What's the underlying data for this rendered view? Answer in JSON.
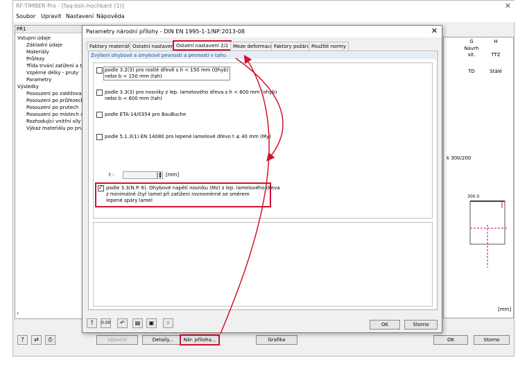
{
  "app": {
    "title": "RF-TIMBER Pro - [faq-bsh-hochkant (1)]",
    "close_glyph": "✕",
    "menu": [
      "Soubor",
      "Upravit",
      "Nastavení",
      "Nápověda"
    ],
    "tree_header": "PŘ1",
    "tree_items": [
      "Vstupní údaje",
      "Základní údaje",
      "Materiály",
      "Průřezy",
      "Třída trvání zatížení a třída",
      "Vzpěrné délky - pruty",
      "Parametry",
      "Výsledky",
      "Posouzení po zatěžovacích",
      "Posouzení po průřezech",
      "Posouzení po prutech",
      "Posouzení po místech x",
      "Rozhodující vnitřní síly po p",
      "Výkaz materiálu po prutech"
    ],
    "right_columns": {
      "g_head": "G",
      "h_head": "H",
      "g_sub1": "Návrh",
      "g_sub2": "sit.",
      "h_sub": "TTZ",
      "g_val": "TD",
      "h_val": "Stálé"
    },
    "section_label": "k 300/200",
    "dim_label": "300.0",
    "unit_label": "[mm]",
    "bottom_buttons": {
      "vypocet": "Výpočet",
      "detaily": "Detaily...",
      "nar_priloha": "Nár. příloha...",
      "grafika": "Grafika",
      "ok": "OK",
      "storno": "Storno"
    }
  },
  "dialog": {
    "title": "Parametry národní přílohy - DIN EN 1995-1-1/NP:2013-08",
    "close_glyph": "✕",
    "tabs": [
      "Faktory materiálu",
      "Ostatní nastavení",
      "Ostatní nastavení 2/2",
      "Meze deformace",
      "Faktory požáru",
      "Použité normy"
    ],
    "active_tab": "Ostatní nastavení 2/2",
    "group_header": "Zvýšení ohybové a smykové pevnosti a pevnosti v tahu",
    "options": [
      {
        "line1": "podle 3.2(3) pro rostlé dřevě s h < 150 mm (Ohyb)",
        "line2": "nebo b < 150 mm (tah)",
        "checked": false
      },
      {
        "line1": "podle 3.3(3) pro nosníky z lep. lamelového dřeva s h < 600 mm (ohyb)",
        "line2": "nebo b < 600 mm (tah)",
        "checked": false
      },
      {
        "line1": "podle ETA-14/0354 pro BauBuche",
        "checked": false
      },
      {
        "line1": "podle 5.1.3(1) EN 14080 pro lepené lamelové dřevo t ≤ 40 mm (My)",
        "checked": false
      }
    ],
    "t_label": "t :",
    "t_unit": "[mm]",
    "highlighted_option": {
      "line1": "podle 3.3(N.P. 6). Ohybové napětí nosníku (Mz) z lep. lamelového dřeva",
      "line2": "z minimálně čtyř lamel při zatížení rovnoměrně se směrem",
      "line3": "lepené spáry lamel",
      "checked": true
    },
    "ok_label": "OK",
    "cancel_label": "Storno"
  },
  "colors": {
    "accent": "#d0102c",
    "header_blue": "#1f4f90"
  }
}
